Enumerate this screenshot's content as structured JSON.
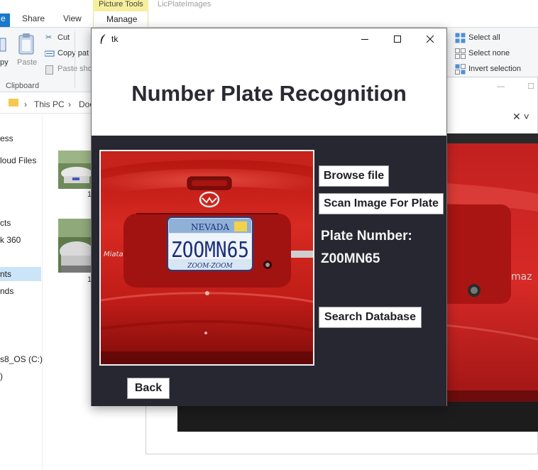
{
  "explorer": {
    "tabs": {
      "file": "e",
      "share": "Share",
      "view": "View",
      "manage_top": "Picture Tools",
      "manage": "Manage"
    },
    "context_title": "LicPlateImages",
    "ribbon": {
      "copy": "py",
      "paste": "Paste",
      "cut": "Cut",
      "copy_path": "Copy pat",
      "paste_shortcut": "Paste sho",
      "clipboard": "Clipboard",
      "select_all": "Select all",
      "select_none": "Select none",
      "invert_selection": "Invert selection"
    },
    "address": {
      "this_pc": "This PC",
      "docs": "Doc"
    },
    "nav_items": [
      "ess",
      "loud Files",
      "cts",
      "k 360",
      "nts",
      "nds",
      "s8_OS (C:)",
      ")"
    ],
    "thumb_captions": [
      "1",
      "1"
    ]
  },
  "tk_window": {
    "title": "tk",
    "heading": "Number Plate Recognition",
    "buttons": {
      "browse": "Browse file",
      "scan": "Scan Image For Plate",
      "search": "Search Database",
      "back": "Back"
    },
    "plate_label": "Plate Number:",
    "plate_value": "Z00MN65",
    "image": {
      "plate_state": "NEVADA",
      "plate_text": "ZOOMN65",
      "plate_tagline": "ZOOM-ZOOM"
    }
  },
  "colors": {
    "tk_body": "#272731",
    "car_red": "#c71d1d",
    "explorer_accent": "#1979ca",
    "picture_tools": "#f6ef9c"
  }
}
